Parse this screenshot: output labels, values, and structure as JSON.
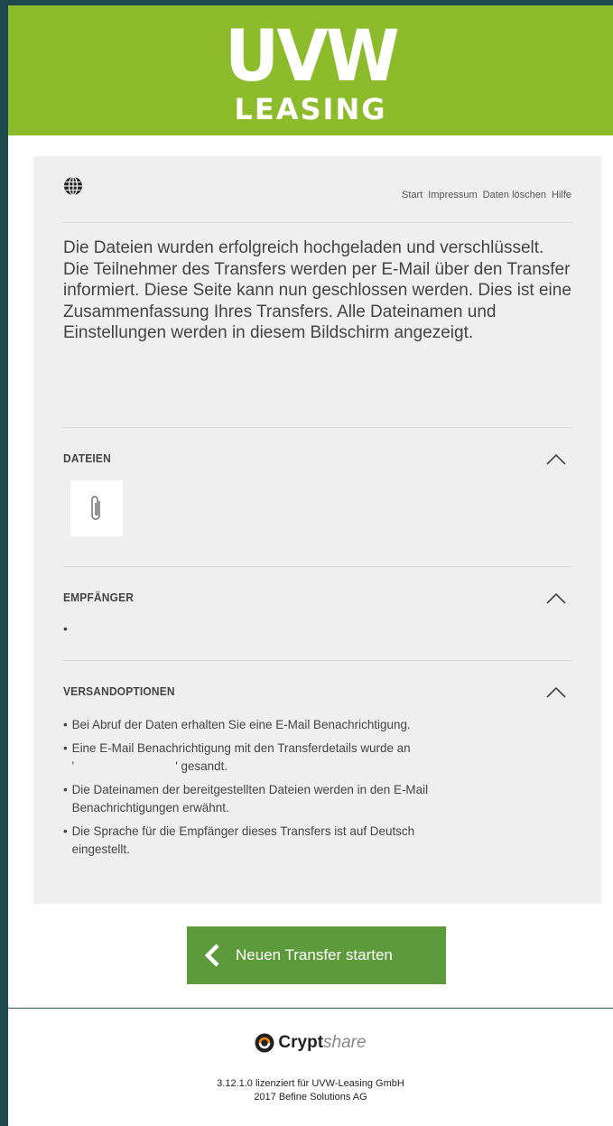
{
  "brand": {
    "logo_top": "UVW",
    "logo_bottom": "LEASING",
    "bar_color": "#8cbb2c"
  },
  "nav": {
    "globe_icon": "globe-icon",
    "links": [
      "Start",
      "Impressum",
      "Daten löschen",
      "Hilfe"
    ]
  },
  "intro_text": "Die Dateien wurden erfolgreich hochgeladen und verschlüsselt. Die Teilnehmer des Transfers werden per E-Mail über den Transfer informiert. Diese Seite kann nun geschlossen werden. Dies ist eine Zusammenfassung Ihres Transfers. Alle Dateinamen und Einstellungen werden in diesem Bildschirm angezeigt.",
  "sections": {
    "files": {
      "title": "DATEIEN",
      "icon": "paperclip-icon"
    },
    "recipients": {
      "title": "EMPFÄNGER",
      "bullet": "•"
    },
    "options": {
      "title": "VERSANDOPTIONEN",
      "items": [
        {
          "line1": "Bei Abruf der Daten erhalten Sie eine E-Mail Benachrichtigung."
        },
        {
          "line1": "Eine E-Mail Benachrichtigung mit den Transferdetails wurde an",
          "line2": "'                              ' gesandt."
        },
        {
          "line1": "Die Dateinamen der bereitgestellten Dateien werden in den E-Mail",
          "line2": "Benachrichtigungen erwähnt."
        },
        {
          "line1": "Die Sprache für die Empfänger dieses Transfers ist auf Deutsch",
          "line2": "eingestellt."
        }
      ]
    }
  },
  "action_button": {
    "label": "Neuen Transfer starten",
    "color": "#5d9a3c"
  },
  "footer": {
    "logo_bold": "Crypt",
    "logo_light": "share",
    "license_line1": "3.12.1.0 lizenziert für UVW-Leasing GmbH",
    "license_line2": "2017 Befine Solutions AG"
  }
}
